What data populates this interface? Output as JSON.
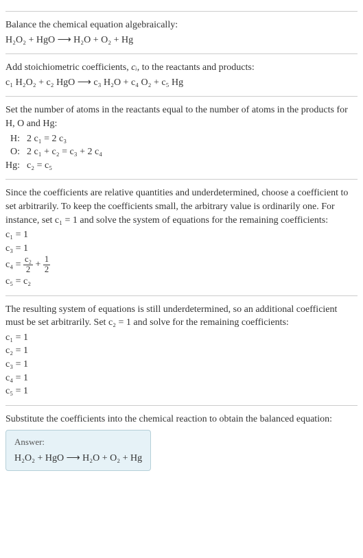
{
  "sec1": {
    "intro": "Balance the chemical equation algebraically:",
    "eq": "H₂O₂ + HgO ⟶ H₂O + O₂ + Hg"
  },
  "sec2": {
    "intro_a": "Add stoichiometric coefficients, ",
    "intro_ci": "cᵢ",
    "intro_b": ", to the reactants and products:",
    "eq": "c₁ H₂O₂ + c₂ HgO ⟶ c₃ H₂O + c₄ O₂ + c₅ Hg"
  },
  "sec3": {
    "intro": "Set the number of atoms in the reactants equal to the number of atoms in the products for H, O and Hg:",
    "rows": [
      {
        "l": "H:",
        "r": "2 c₁ = 2 c₃"
      },
      {
        "l": "O:",
        "r": "2 c₁ + c₂ = c₃ + 2 c₄"
      },
      {
        "l": "Hg:",
        "r": "c₂ = c₅"
      }
    ]
  },
  "sec4": {
    "intro": "Since the coefficients are relative quantities and underdetermined, choose a coefficient to set arbitrarily. To keep the coefficients small, the arbitrary value is ordinarily one. For instance, set c₁ = 1 and solve the system of equations for the remaining coefficients:",
    "lines": {
      "l1": "c₁ = 1",
      "l2": "c₃ = 1",
      "l3a": "c₄ = ",
      "l3f1n": "c₂",
      "l3f1d": "2",
      "l3mid": " + ",
      "l3f2n": "1",
      "l3f2d": "2",
      "l4": "c₅ = c₂"
    }
  },
  "sec5": {
    "intro": "The resulting system of equations is still underdetermined, so an additional coefficient must be set arbitrarily. Set c₂ = 1 and solve for the remaining coefficients:",
    "lines": [
      "c₁ = 1",
      "c₂ = 1",
      "c₃ = 1",
      "c₄ = 1",
      "c₅ = 1"
    ]
  },
  "sec6": {
    "intro": "Substitute the coefficients into the chemical reaction to obtain the balanced equation:",
    "answer_label": "Answer:",
    "answer_eq": "H₂O₂ + HgO ⟶ H₂O + O₂ + Hg"
  },
  "chart_data": {
    "type": "table",
    "title": "Stoichiometric coefficients for H2O2 + HgO → H2O + O2 + Hg",
    "series": [
      {
        "name": "c1",
        "species": "H2O2",
        "value": 1
      },
      {
        "name": "c2",
        "species": "HgO",
        "value": 1
      },
      {
        "name": "c3",
        "species": "H2O",
        "value": 1
      },
      {
        "name": "c4",
        "species": "O2",
        "value": 1
      },
      {
        "name": "c5",
        "species": "Hg",
        "value": 1
      }
    ],
    "atom_balance": [
      {
        "element": "H",
        "equation": "2 c1 = 2 c3"
      },
      {
        "element": "O",
        "equation": "2 c1 + c2 = c3 + 2 c4"
      },
      {
        "element": "Hg",
        "equation": "c2 = c5"
      }
    ]
  }
}
